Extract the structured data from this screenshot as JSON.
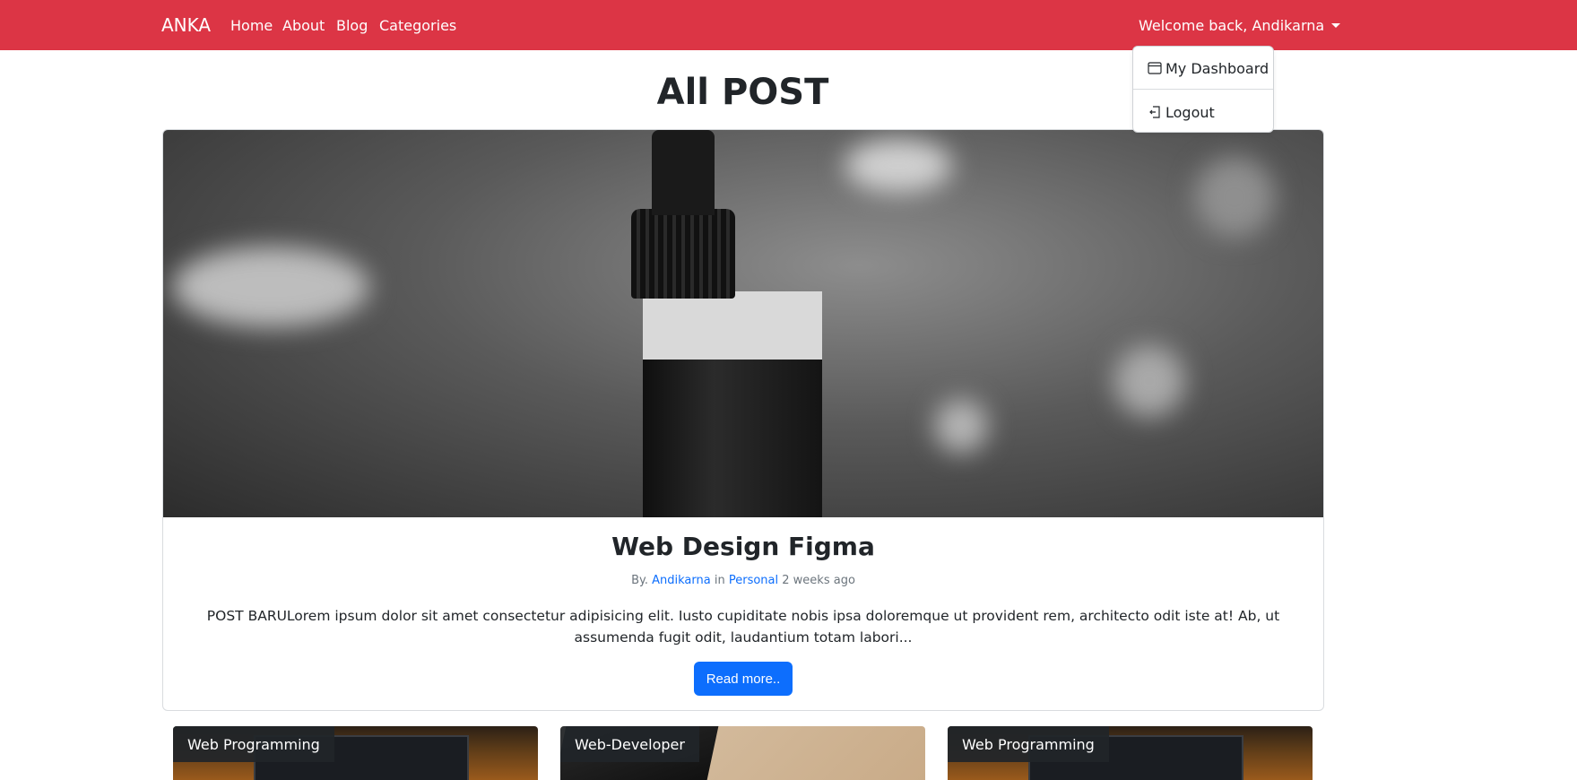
{
  "navbar": {
    "brand": "ANKA",
    "links": [
      "Home",
      "About",
      "Blog",
      "Categories"
    ],
    "welcome": "Welcome back, Andikarna",
    "color": "#dc3545"
  },
  "dropdown": {
    "items": [
      {
        "label": "My Dashboard",
        "icon": "window-icon"
      },
      {
        "label": "Logout",
        "icon": "logout-icon"
      }
    ]
  },
  "page": {
    "title": "All POST"
  },
  "featured_post": {
    "title": "Web Design Figma",
    "meta_prefix": "By.",
    "author": "Andikarna",
    "meta_in": "in",
    "category": "Personal",
    "time": "2 weeks ago",
    "excerpt": "POST BARULorem ipsum dolor sit amet consectetur adipisicing elit. Iusto cupiditate nobis ipsa doloremque ut provident rem, architecto odit iste at! Ab, ut assumenda fugit odit, laudantium totam labori...",
    "button_label": "Read more.."
  },
  "post_cards": [
    {
      "category": "Web Programming"
    },
    {
      "category": "Web-Developer"
    },
    {
      "category": "Web Programming"
    }
  ]
}
